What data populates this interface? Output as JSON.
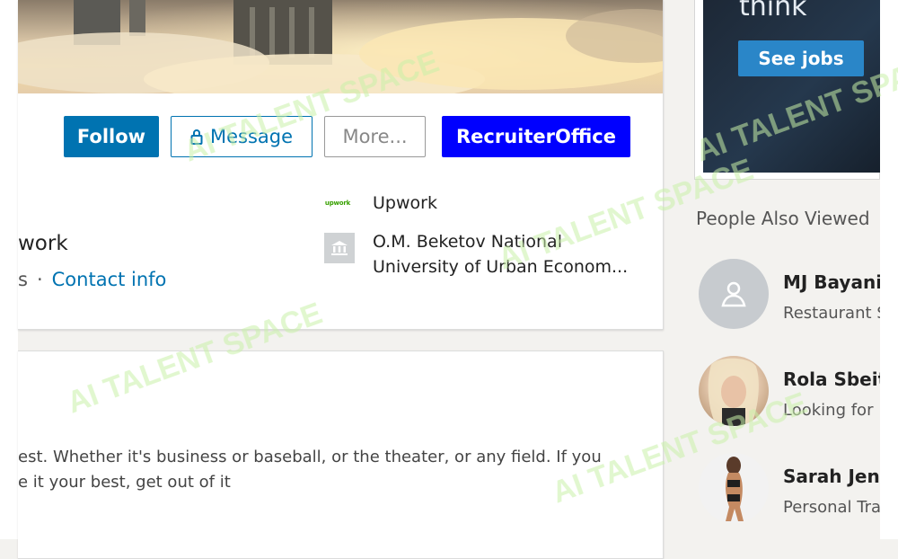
{
  "profile": {
    "buttons": {
      "follow": "Follow",
      "message": "Message",
      "more": "More...",
      "recruiter": "RecruiterOffice"
    },
    "headline_fragment": "work",
    "contact_prefix": "s",
    "contact_separator": "·",
    "contact_info": "Contact info",
    "company": {
      "logo_text": "upwork",
      "name": "Upwork"
    },
    "school": {
      "line1": "O.M. Beketov National",
      "line2": "University of Urban Econom..."
    }
  },
  "about": {
    "line1": "est. Whether it's business or baseball, or the theater, or any field. If you",
    "line2": "e it your best, get out of it"
  },
  "ad": {
    "headline": "think",
    "button": "See jobs"
  },
  "people_also_viewed": {
    "title": "People Also Viewed",
    "people": [
      {
        "name": "MJ Bayani",
        "subtitle": "Restaurant S",
        "avatar": "placeholder-person-icon"
      },
      {
        "name": "Rola Sbeit",
        "subtitle": "Looking for",
        "avatar": "photo"
      },
      {
        "name": "Sarah Jenl",
        "subtitle": "Personal Tra",
        "avatar": "photo"
      }
    ]
  },
  "watermark": {
    "text": "AI TALENT SPACE"
  },
  "colors": {
    "linkedin_blue": "#0073b1",
    "recruiter_blue": "#0000ff",
    "ad_button": "#2a86c8",
    "upwork_green": "#37a000",
    "watermark_green": "#c8f0a8"
  }
}
